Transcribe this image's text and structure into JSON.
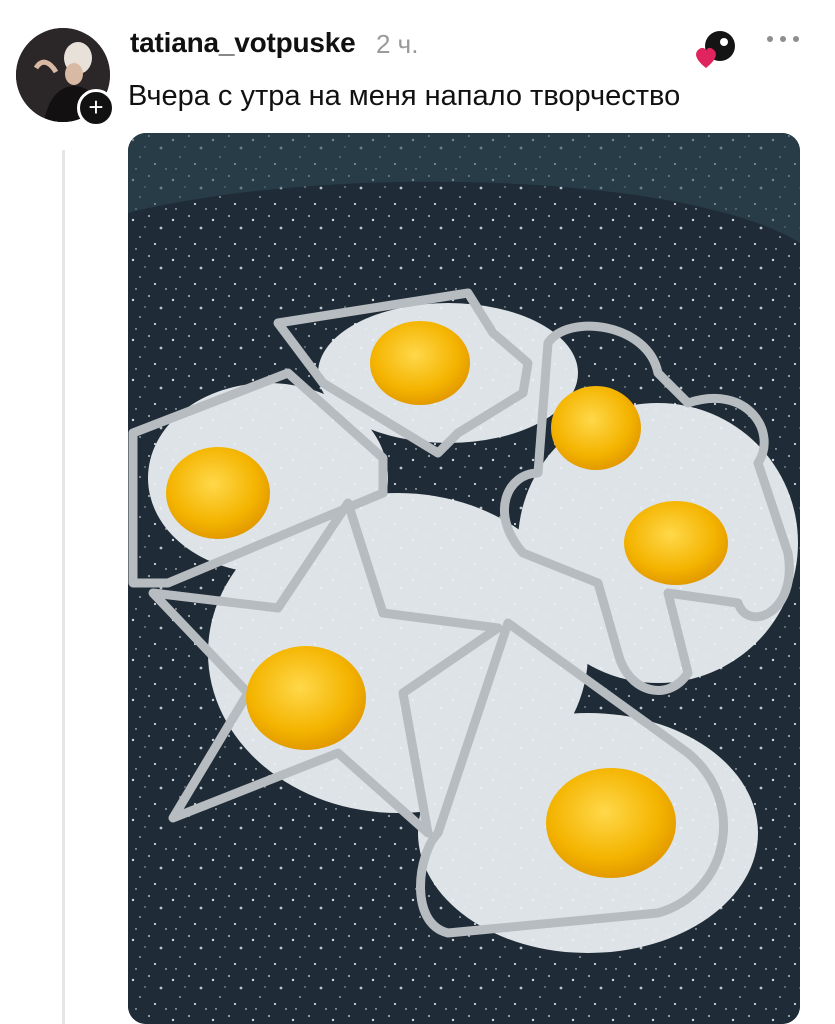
{
  "post": {
    "username": "tatiana_votpuske",
    "time": "2 ч.",
    "caption": "Вчера с утра на меня напало творчество",
    "follow_symbol": "+"
  },
  "icons": {
    "avatar": "profile-photo",
    "follow": "plus-icon",
    "like": "heart-icon",
    "more": "more-dots-icon"
  },
  "colors": {
    "text": "#111111",
    "muted": "#9a9a9a",
    "like": "#e0245e",
    "pan": "#1f2b36",
    "yolk": "#f4b400"
  }
}
